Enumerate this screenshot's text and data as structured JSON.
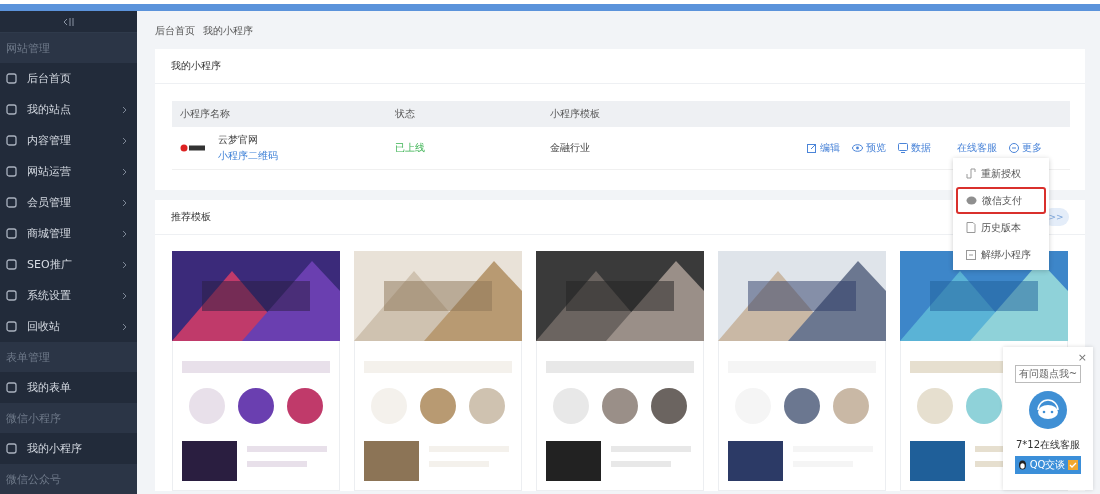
{
  "sidebar": {
    "groups": [
      {
        "title": "网站管理",
        "items": [
          {
            "label": "后台首页",
            "expandable": false
          },
          {
            "label": "我的站点",
            "expandable": true
          },
          {
            "label": "内容管理",
            "expandable": true
          },
          {
            "label": "网站运营",
            "expandable": true
          },
          {
            "label": "会员管理",
            "expandable": true
          },
          {
            "label": "商城管理",
            "expandable": true
          },
          {
            "label": "SEO推广",
            "expandable": true
          },
          {
            "label": "系统设置",
            "expandable": true
          },
          {
            "label": "回收站",
            "expandable": true
          }
        ]
      },
      {
        "title": "表单管理",
        "items": [
          {
            "label": "我的表单",
            "expandable": false
          }
        ]
      },
      {
        "title": "微信小程序",
        "items": [
          {
            "label": "我的小程序",
            "expandable": false
          }
        ]
      },
      {
        "title": "微信公众号"
      }
    ]
  },
  "breadcrumb": [
    "后台首页",
    "我的小程序"
  ],
  "miniapp_card": {
    "title": "我的小程序",
    "columns": [
      "小程序名称",
      "状态",
      "小程序模板"
    ],
    "rows": [
      {
        "name": "云梦官网",
        "qr_link": "小程序二维码",
        "status": "已上线",
        "template": "金融行业",
        "actions": [
          "编辑",
          "预览",
          "数据",
          "在线客服",
          "更多"
        ]
      }
    ]
  },
  "more_menu": [
    {
      "label": "重新授权",
      "highlighted": false
    },
    {
      "label": "微信支付",
      "highlighted": true
    },
    {
      "label": "历史版本",
      "highlighted": false
    },
    {
      "label": "解绑小程序",
      "highlighted": false
    }
  ],
  "templates_card": {
    "title": "推荐模板",
    "next_button": ">>"
  },
  "chat_widget": {
    "close": "×",
    "bubble": "有问题点我~",
    "caption": "7*12在线客服",
    "qq_button": "QQ交谈"
  }
}
